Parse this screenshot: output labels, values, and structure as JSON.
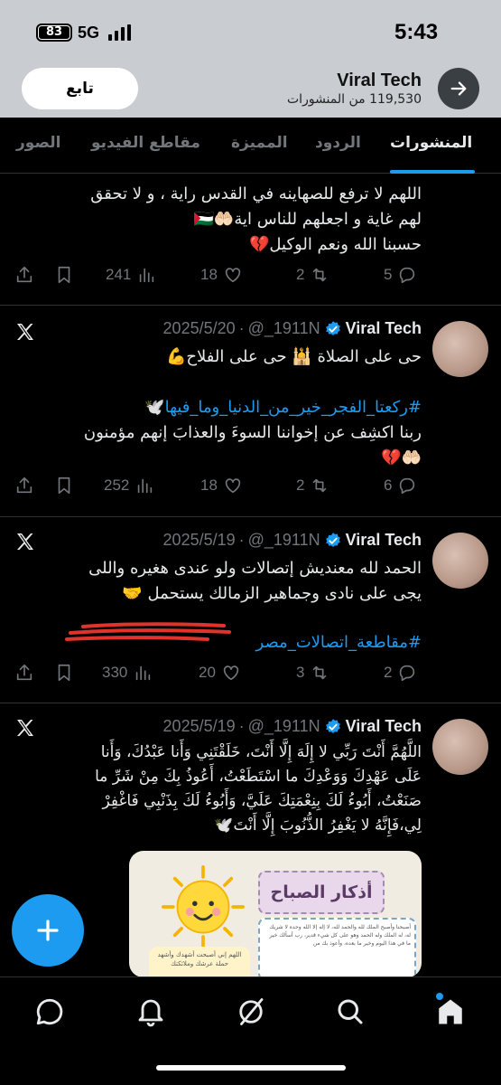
{
  "status_bar": {
    "time": "5:43",
    "battery": "83",
    "network": "5G"
  },
  "profile": {
    "name": "Viral Tech",
    "posts_count": "119,530 من المنشورات",
    "follow_label": "تابع"
  },
  "tabs": [
    {
      "label": "المنشورات",
      "active": true
    },
    {
      "label": "الردود",
      "active": false
    },
    {
      "label": "المميزة",
      "active": false
    },
    {
      "label": "مقاطع الفيديو",
      "active": false
    },
    {
      "label": "الصور",
      "active": false
    }
  ],
  "tweets": [
    {
      "lines": [
        "اللهم لا ترفع للصهاينه في القدس راية ، و لا تحقق",
        "لهم غاية و اجعلهم للناس اية🤲🏻🇵🇸",
        "حسبنا الله ونعم الوكيل💔"
      ],
      "replies": "5",
      "reposts": "2",
      "likes": "18",
      "views": "241"
    },
    {
      "name": "Viral Tech",
      "handle": "@_1911N",
      "date": "2025/5/20",
      "lines": [
        "حى على الصلاة 🕌 حى على الفلاح💪",
        "",
        "#ركعتا_الفجر_خير_من_الدنيا_وما_فيها🕊️",
        "ربنا اكشِف عن إخواننا السوءَ والعذابَ إنهم مؤمنون",
        "🤲🏻💔"
      ],
      "replies": "6",
      "reposts": "2",
      "likes": "18",
      "views": "252"
    },
    {
      "name": "Viral Tech",
      "handle": "@_1911N",
      "date": "2025/5/19",
      "lines": [
        "الحمد لله معنديش إتصالات ولو عندى هغيره واللى",
        "يجى على نادى وجماهير الزمالك يستحمل 🤝"
      ],
      "hashtag": "#مقاطعة_اتصالات_مصر",
      "replies": "2",
      "reposts": "3",
      "likes": "20",
      "views": "330"
    },
    {
      "name": "Viral Tech",
      "handle": "@_1911N",
      "date": "2025/5/19",
      "lines": [
        "اللَّهُمَّ أَنْتَ رَبِّي لا إِلَهَ إِلَّا أَنْتَ، خَلَقْتَنِي وَأَنا عَبْدُكَ، وَأَنا",
        "عَلَى عَهْدِكَ وَوَعْدِكَ ما اسْتَطَعْتُ، أَعُوذُ بِكَ مِنْ شَرِّ ما",
        "صَنَعْتُ، أَبُوءُ لَكَ بِنِعْمَتِكَ عَلَيَّ، وَأَبُوءُ لَكَ بِذَنْبِي فَاغْفِرْ",
        "لِي،فَإِنَّهُ لا يَغْفِرُ الذُّنُوبَ إِلَّا أَنْتَ🕊️"
      ],
      "media": {
        "title": "أذكار الصباح",
        "text_right": "أصبحنا وأصبح الملك لله والحمد لله، لا إله إلا الله وحده لا شريك له، له الملك وله الحمد وهو على كل شيء قدير، رب أسألك خير ما في هذا اليوم وخير ما بعده، وأعوذ بك من",
        "text_left": "اللهم إني أصبحت أشهدك وأشهد حملة عرشك وملائكتك"
      }
    }
  ],
  "colors": {
    "accent": "#1d9bf0",
    "muted": "#71767b",
    "divider": "#2f3336"
  }
}
